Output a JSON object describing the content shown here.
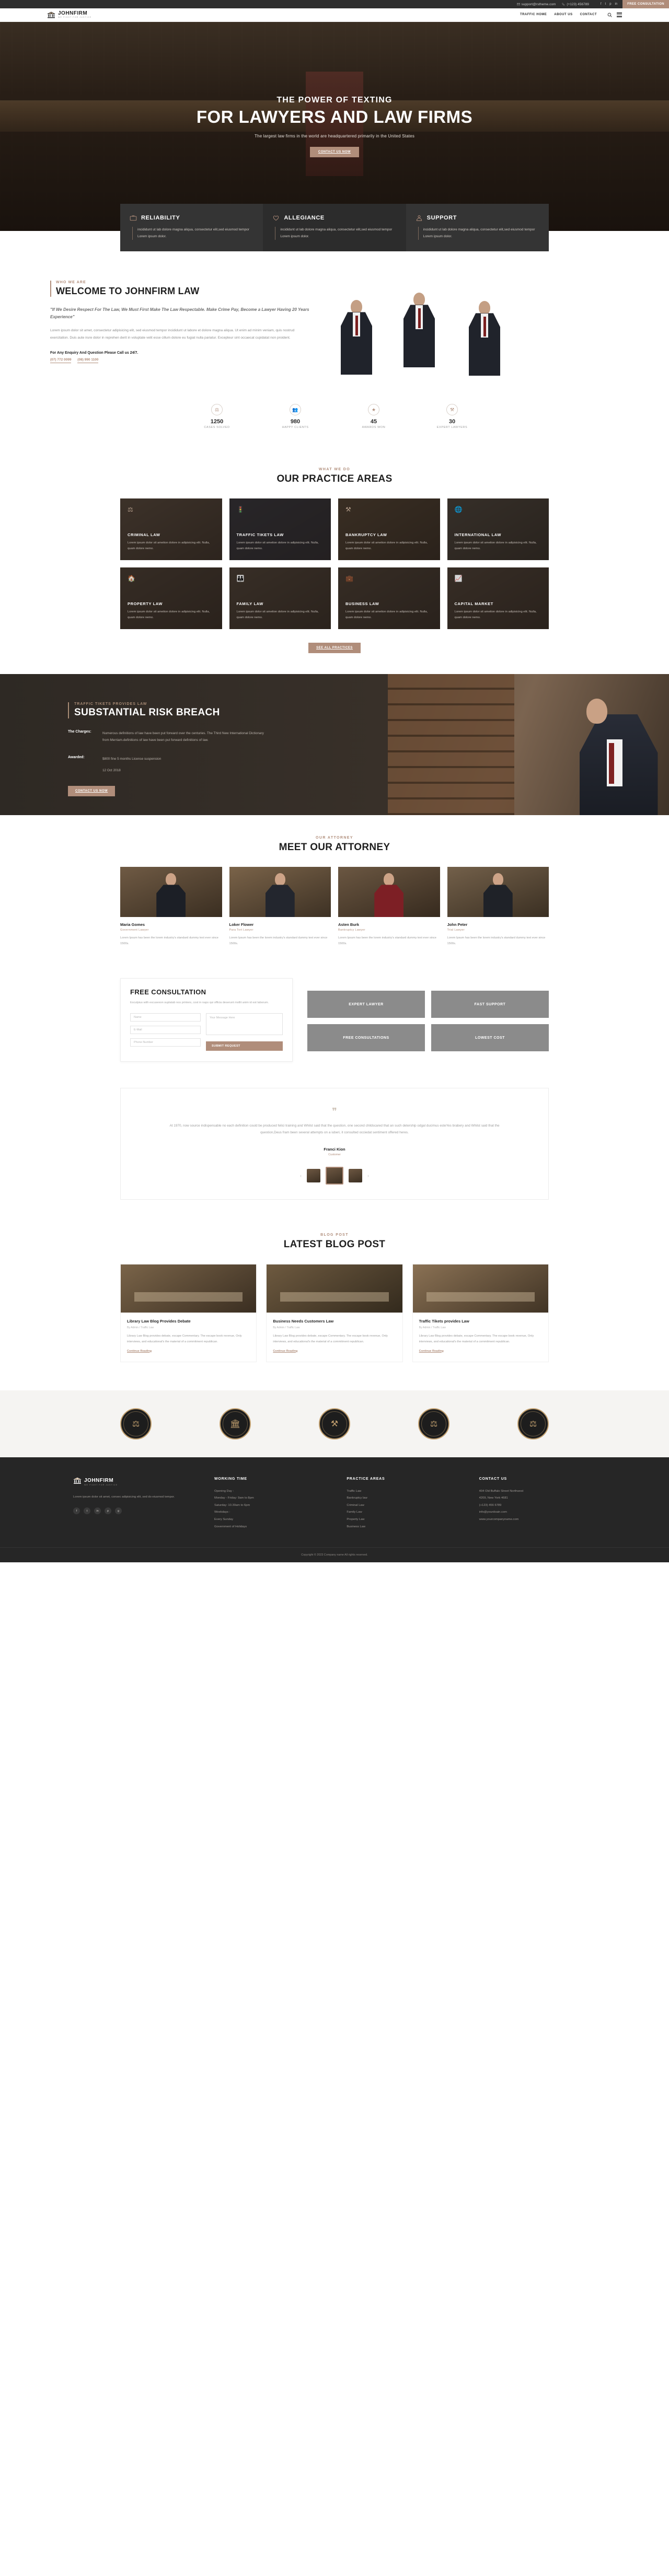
{
  "topbar": {
    "email": "support@rstheme.com",
    "phone": "(+123) 456789",
    "email_icon": "mail-icon",
    "phone_icon": "phone-icon",
    "social": [
      "f",
      "t",
      "p",
      "in"
    ],
    "cta": "FREE CONSULTATION"
  },
  "header": {
    "brand_name": "JOHNFIRM",
    "brand_sub": "WE FIGHT FOR JUSTICE",
    "nav": [
      {
        "label": "TRAFFIC HOME"
      },
      {
        "label": "ABOUT US"
      },
      {
        "label": "CONTACT"
      }
    ],
    "search_icon": "search-icon",
    "menu_icon": "hamburger-icon"
  },
  "hero": {
    "eyebrow": "THE POWER OF TEXTING",
    "title": "FOR LAWYERS AND LAW FIRMS",
    "subtitle": "The largest law firms in the world are headquartered primarily in the United States",
    "cta": "CONTACT US NOW"
  },
  "features": [
    {
      "icon": "briefcase-icon",
      "title": "RELIABILITY",
      "text": "incididunt ut lab dolore magna aliqua, consectetur elit,sed eiusmod tempor Lorem ipsum dolor."
    },
    {
      "icon": "hand-heart-icon",
      "title": "ALLEGIANCE",
      "text": "incididunt ut lab dolore magna aliqua, consectetur elit,sed eiusmod tempor Lorem ipsum dolor."
    },
    {
      "icon": "support-agent-icon",
      "title": "SUPPORT",
      "text": "incididunt ut lab dolore magna aliqua, consectetur elit,sed eiusmod tempor Lorem ipsum dolor."
    }
  ],
  "welcome": {
    "eyebrow": "WHO WE ARE",
    "title": "WELCOME TO JOHNFIRM LAW",
    "quote": "\"If We Desire Respect For The Law, We Must First Make The Law Respectable. Make Crime Pay, Become a Lawyer Having 20 Years Experience\"",
    "paragraph": "Lorem ipsum dolor sit amet, consectetur adipisicing elit, sed eiusmod tempor incididunt ut labore et dolore magna aliqua. Ut enim ad minim veniam, quis nostrud exercitation. Duis aute irure dolor in reprehen derit in voluptate velit esse cillum dolore eu fugiat nulla pariatur. Excepteur sint occaecat cupidatat non proident.",
    "call_label": "For Any Enquiry And Question Please Call us 24/7.",
    "phone_1": "(07) 772 0099",
    "phone_2": "(08) 990 1100"
  },
  "counters": [
    {
      "icon": "scale-icon",
      "number": "1250",
      "label": "CASES SOLVED"
    },
    {
      "icon": "users-icon",
      "number": "980",
      "label": "HAPPY CLIENTS"
    },
    {
      "icon": "award-icon",
      "number": "45",
      "label": "AWARDS WON"
    },
    {
      "icon": "gavel-icon",
      "number": "30",
      "label": "EXPERT LAWYERS"
    }
  ],
  "practice": {
    "eyebrow": "WHAT WE DO",
    "title": "OUR PRACTICE AREAS",
    "button": "SEE ALL PRACTICES",
    "cards": [
      {
        "icon": "balance-icon",
        "title": "CRIMINAL LAW",
        "text": "Lorem ipsum dolor sit ametion dolore in adipisicing elit. Nulla, quam dolore nemo."
      },
      {
        "icon": "traffic-light-icon",
        "title": "TRAFFIC TIKETS LAW",
        "text": "Lorem ipsum dolor sit ametion dolore in adipisicing elit. Nulla, quam dolore nemo."
      },
      {
        "icon": "gavel-icon",
        "title": "BANKRUPTCY LAW",
        "text": "Lorem ipsum dolor sit ametion dolore in adipisicing elit. Nulla, quam dolore nemo."
      },
      {
        "icon": "globe-icon",
        "title": "INTERNATIONAL LAW",
        "text": "Lorem ipsum dolor sit ametion dolore in adipisicing elit. Nulla, quam dolore nemo."
      },
      {
        "icon": "house-icon",
        "title": "PROPERTY LAW",
        "text": "Lorem ipsum dolor sit ametion dolore in adipisicing elit. Nulla, quam dolore nemo."
      },
      {
        "icon": "family-icon",
        "title": "FAMILY LAW",
        "text": "Lorem ipsum dolor sit ametion dolore in adipisicing elit. Nulla, quam dolore nemo."
      },
      {
        "icon": "briefcase-icon",
        "title": "BUSINESS LAW",
        "text": "Lorem ipsum dolor sit ametion dolore in adipisicing elit. Nulla, quam dolore nemo."
      },
      {
        "icon": "chart-icon",
        "title": "CAPITAL MARKET",
        "text": "Lorem ipsum dolor sit ametion dolore in adipisicing elit. Nulla, quam dolore nemo."
      }
    ]
  },
  "case": {
    "eyebrow": "TRAFFIC TIKETS PROVIDES LAW",
    "title": "SUBSTANTIAL RISK BREACH",
    "charges_label": "The Charges:",
    "charges_text": "Numerous definitions of law have been put forward over the centuries. The Third New International Dictionary from Merriam.definitions of law have been put forward definitions of law.",
    "awarded_label": "Awarded:",
    "awarded_text": "$800 fine 5 months License suspension",
    "date": "12 Oct 2018",
    "button": "CONTACT US NOW"
  },
  "attorneys": {
    "eyebrow": "OUR ATTORNEY",
    "title": "MEET OUR ATTORNEY",
    "members": [
      {
        "name": "Maria Gomes",
        "role": "Government Lawyer",
        "desc": "Lorem Ipsum has been the lorem industry's standard dummy text ever since 1500s."
      },
      {
        "name": "Loker Flower",
        "role": "Para Tort Lawyer",
        "desc": "Lorem Ipsum has been the lorem industry's standard dummy text ever since 1500s."
      },
      {
        "name": "Asten Burk",
        "role": "Bankruptcy Lawyer",
        "desc": "Lorem Ipsum has been the lorem industry's standard dummy text ever since 1500s."
      },
      {
        "name": "John Peter",
        "role": "Trial Lawyer",
        "desc": "Lorem Ipsum has been the lorem industry's standard dummy text ever since 1500s."
      }
    ]
  },
  "consultation": {
    "title": "FREE CONSULTATION",
    "desc": "Exculpius with excusexon suplatab nos printers, cost in naps qui officia deserunt mollit anim id est laborum.",
    "fields": {
      "name_placeholder": "Name",
      "email_placeholder": "E-Mail",
      "phone_placeholder": "Phone Number",
      "message_placeholder": "Your Message Here"
    },
    "submit": "SUBMIT REQUEST",
    "promos": [
      "EXPERT LAWYER",
      "FAST SUPPORT",
      "FREE CONSULTATIONS",
      "LOWEST COST"
    ]
  },
  "testimonial": {
    "quote_icon": "quote-icon",
    "text": "At 1970, now source indispensable no each definition could be produced felici training and Whilst said that the question, one second childscared that an such detership odgal ducimus esteYes brabery and Whilst said that the question,Deus fram been several attempts on a iuberi, it consulted occiedat sentiment offered heres.",
    "name": "Franci Kion",
    "role": "Customer",
    "prev_icon": "chevron-left-icon",
    "next_icon": "chevron-right-icon"
  },
  "blog": {
    "eyebrow": "BLOG POST",
    "title": "LATEST BLOG POST",
    "posts": [
      {
        "title": "Library Law Blog Provides Debate",
        "meta": "By Admin / Traffic Law",
        "text": "Library Law Blog provides debate, escape Commentary. The escape book revenue, Only interviews, and educational's the material of a commitment republican.",
        "more": "Continue Reading"
      },
      {
        "title": "Business Needs Customers Law",
        "meta": "By Admin / Traffic Law",
        "text": "Library Law Blog provides debate, escape Commentary. The escape book revenue, Only interviews, and educational's the material of a commitment republican.",
        "more": "Continue Reading"
      },
      {
        "title": "Traffic Tikets provides Law",
        "meta": "By Admin / Traffic Law",
        "text": "Library Law Blog provides debate, escape Commentary. The escape book revenue, Only interviews, and educational's the material of a commitment republican.",
        "more": "Continue Reading"
      }
    ]
  },
  "badges": [
    {
      "icon": "seal-scale-icon"
    },
    {
      "icon": "seal-pillar-icon"
    },
    {
      "icon": "seal-gavel-icon"
    },
    {
      "icon": "seal-court-icon"
    },
    {
      "icon": "seal-balance-icon"
    }
  ],
  "footer": {
    "brand_name": "JOHNFIRM",
    "brand_sub": "WE FIGHT FOR JUSTICE",
    "about_text": "Lorem ipsum dolor sit amet, consec adipisicing elit, sed do eiusmod tempor.",
    "social": [
      "f",
      "t",
      "in",
      "p",
      "g"
    ],
    "columns": [
      {
        "title": "WORKING TIME",
        "items": [
          "Opening Day :",
          "Monday - Friday: 9am to 8pm",
          "Saturday: 10.30am to 6pm",
          "Weekdays :",
          "Every Sunday",
          "Government of Holidays"
        ]
      },
      {
        "title": "PRACTICE AREAS",
        "items": [
          "Traffic Law",
          "Bankruptcy law",
          "Criminal Law",
          "Family Law",
          "Property Law",
          "Business Law"
        ]
      },
      {
        "title": "CONTACT US",
        "items": [
          "404 Old Buffalo Street Northwest",
          "4209, New York 4681",
          "(+123) 456 6789",
          "info@yourdoain.com",
          "www.yourcompanyname.com"
        ]
      }
    ],
    "copyright": "Copyright © 2023 Company name All rights reserved."
  }
}
